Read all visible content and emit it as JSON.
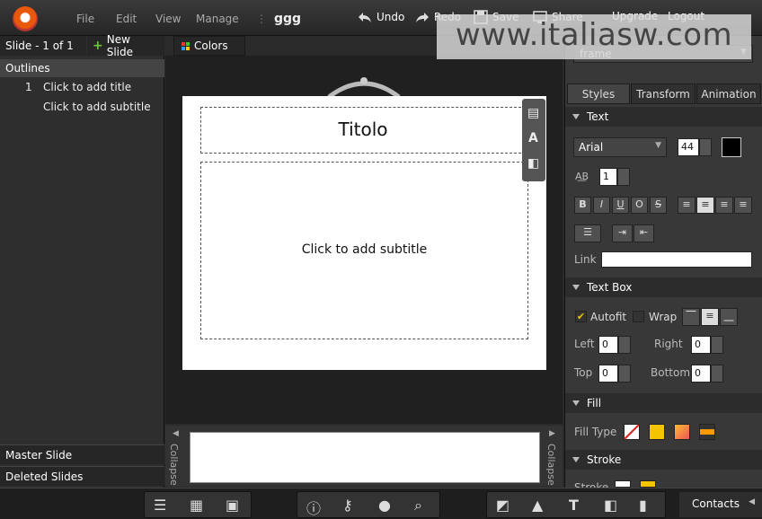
{
  "topbar": {
    "menu": [
      "File",
      "Edit",
      "View",
      "Manage"
    ],
    "doc_name": "ggg",
    "undo": "Undo",
    "redo": "Redo",
    "save": "Save",
    "share": "Share",
    "upgrade": "Upgrade",
    "logout": "Logout"
  },
  "watermark": "www.italiasw.com",
  "left": {
    "slide_count": "Slide - 1 of 1",
    "new_slide": "New Slide",
    "outlines": "Outlines",
    "outline_items": [
      {
        "num": "1",
        "text": "Click to add title"
      },
      {
        "num": "",
        "text": "Click to add subtitle"
      }
    ],
    "master_slide": "Master Slide",
    "deleted_slides": "Deleted Slides"
  },
  "center": {
    "colors": "Colors",
    "title_text": "Titolo",
    "subtitle_text": "Click to add subtitle",
    "collapse": "Collapse"
  },
  "right": {
    "frame": "frame",
    "tabs": [
      "Styles",
      "Transform",
      "Animation"
    ],
    "text_section": "Text",
    "font": "Arial",
    "font_size": "44",
    "spacing": "1",
    "link_label": "Link",
    "textbox_section": "Text Box",
    "autofit": "Autofit",
    "wrap": "Wrap",
    "left_label": "Left",
    "right_label": "Right",
    "top_label": "Top",
    "bottom_label": "Bottom",
    "left_val": "0",
    "right_val": "0",
    "top_val": "0",
    "bottom_val": "0",
    "fill_section": "Fill",
    "fill_type": "Fill Type",
    "stroke_section": "Stroke",
    "stroke_label": "Stroke",
    "format_buttons": [
      "B",
      "I",
      "U",
      "O",
      "S"
    ]
  },
  "bottom": {
    "contacts": "Contacts"
  },
  "colors": {
    "accent_orange": "#e8590c",
    "fill_yellow": "#f5c400"
  }
}
